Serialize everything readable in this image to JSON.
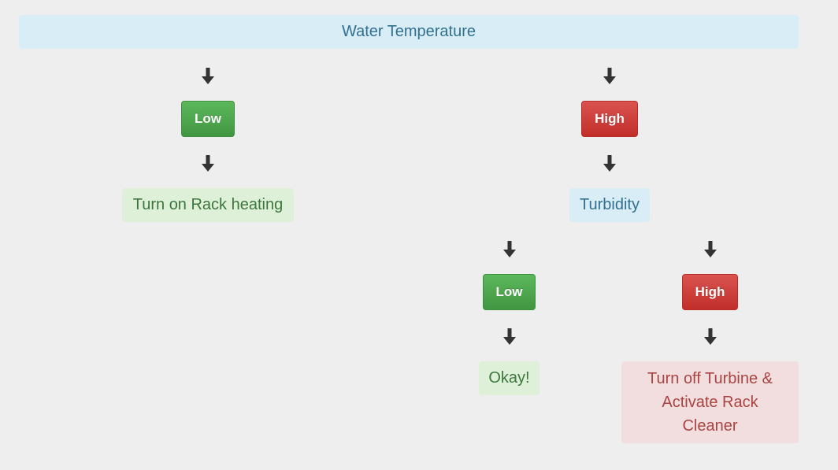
{
  "root": {
    "label": "Water Temperature"
  },
  "branches": {
    "temp_low": {
      "label": "Low",
      "action": "Turn on Rack heating"
    },
    "temp_high": {
      "label": "High",
      "next": "Turbidity"
    },
    "turbidity_low": {
      "label": "Low",
      "action": "Okay!"
    },
    "turbidity_high": {
      "label": "High",
      "action_lines": [
        "Turn off Turbine &",
        "Activate Rack",
        "Cleaner"
      ]
    }
  },
  "colors": {
    "background": "#eeeeee",
    "info": "#d9edf7",
    "success": "#dff0d8",
    "danger": "#f2dede",
    "btn_success": "#4cae4c",
    "btn_danger": "#d2322d",
    "arrow": "#333333"
  },
  "icons": {
    "arrow": "arrow-down-icon"
  }
}
